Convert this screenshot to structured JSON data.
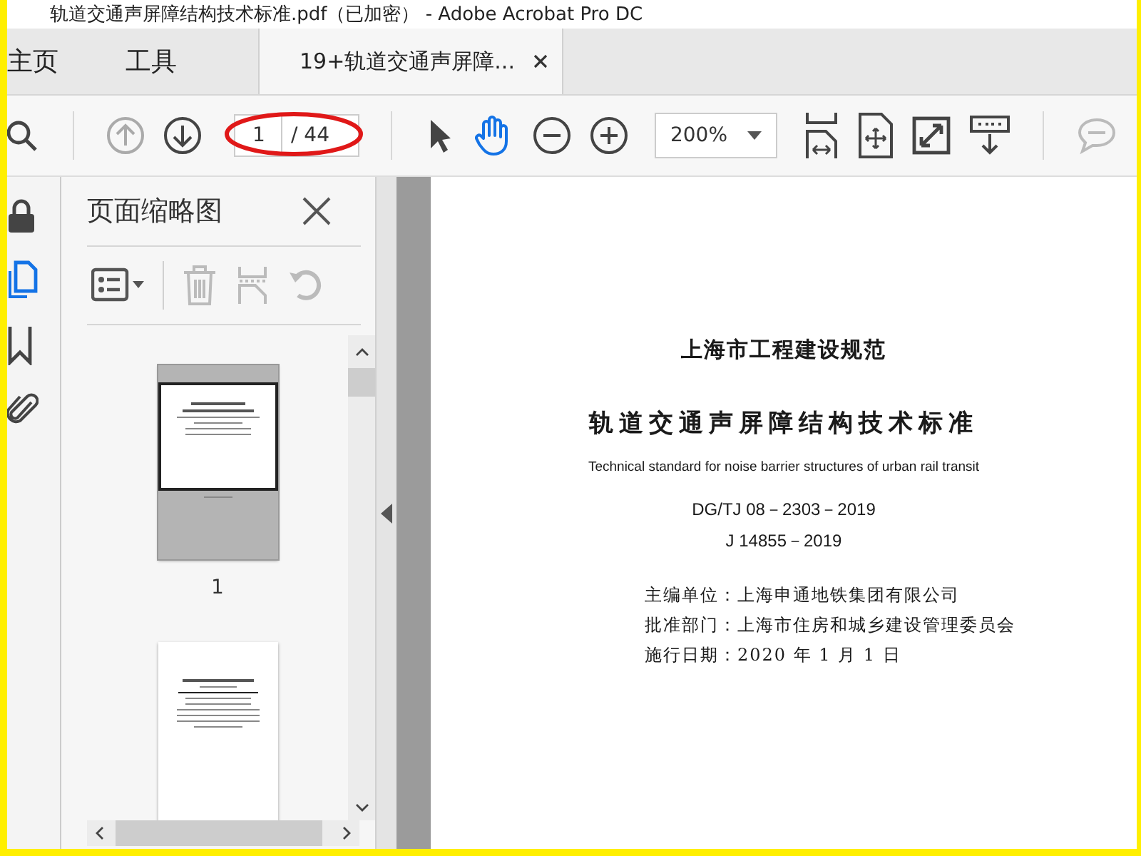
{
  "window": {
    "title": "轨道交通声屏障结构技术标准.pdf（已加密） - Adobe Acrobat Pro DC"
  },
  "tabs": [
    {
      "label": "主页",
      "selected": false,
      "kind": "nav"
    },
    {
      "label": "工具",
      "selected": false,
      "kind": "nav"
    },
    {
      "label": "19+轨道交通声屏障...",
      "selected": true,
      "kind": "document"
    }
  ],
  "toolbar": {
    "page_number": "1",
    "page_count": "/ 44",
    "zoom": "200%",
    "tools": [
      {
        "kind": "select",
        "selected": false
      },
      {
        "kind": "hand",
        "selected": true
      }
    ]
  },
  "side_rail": [
    {
      "kind": "lock",
      "selected": false
    },
    {
      "kind": "pages",
      "selected": true
    },
    {
      "kind": "bookmark",
      "selected": false
    },
    {
      "kind": "attachment",
      "selected": false
    }
  ],
  "thumbnails_panel": {
    "title": "页面缩略图",
    "thumbnails": [
      {
        "label": "1",
        "selected": true
      },
      {
        "selected": false
      }
    ]
  },
  "document": {
    "lines": [
      {
        "kind": "heading",
        "text": "上海市工程建设规范"
      },
      {
        "kind": "title",
        "text": "轨道交通声屏障结构技术标准"
      },
      {
        "kind": "english",
        "text": "Technical standard for noise barrier structures of urban rail transit"
      },
      {
        "kind": "code",
        "text": "DG/TJ 08－2303－2019"
      },
      {
        "kind": "code",
        "text": "J 14855－2019"
      },
      {
        "kind": "info",
        "text": "主编单位：上海申通地铁集团有限公司"
      },
      {
        "kind": "info",
        "text": "批准部门：上海市住房和城乡建设管理委员会"
      },
      {
        "kind": "info",
        "text": "施行日期：2020 年 1 月 1 日"
      }
    ]
  }
}
